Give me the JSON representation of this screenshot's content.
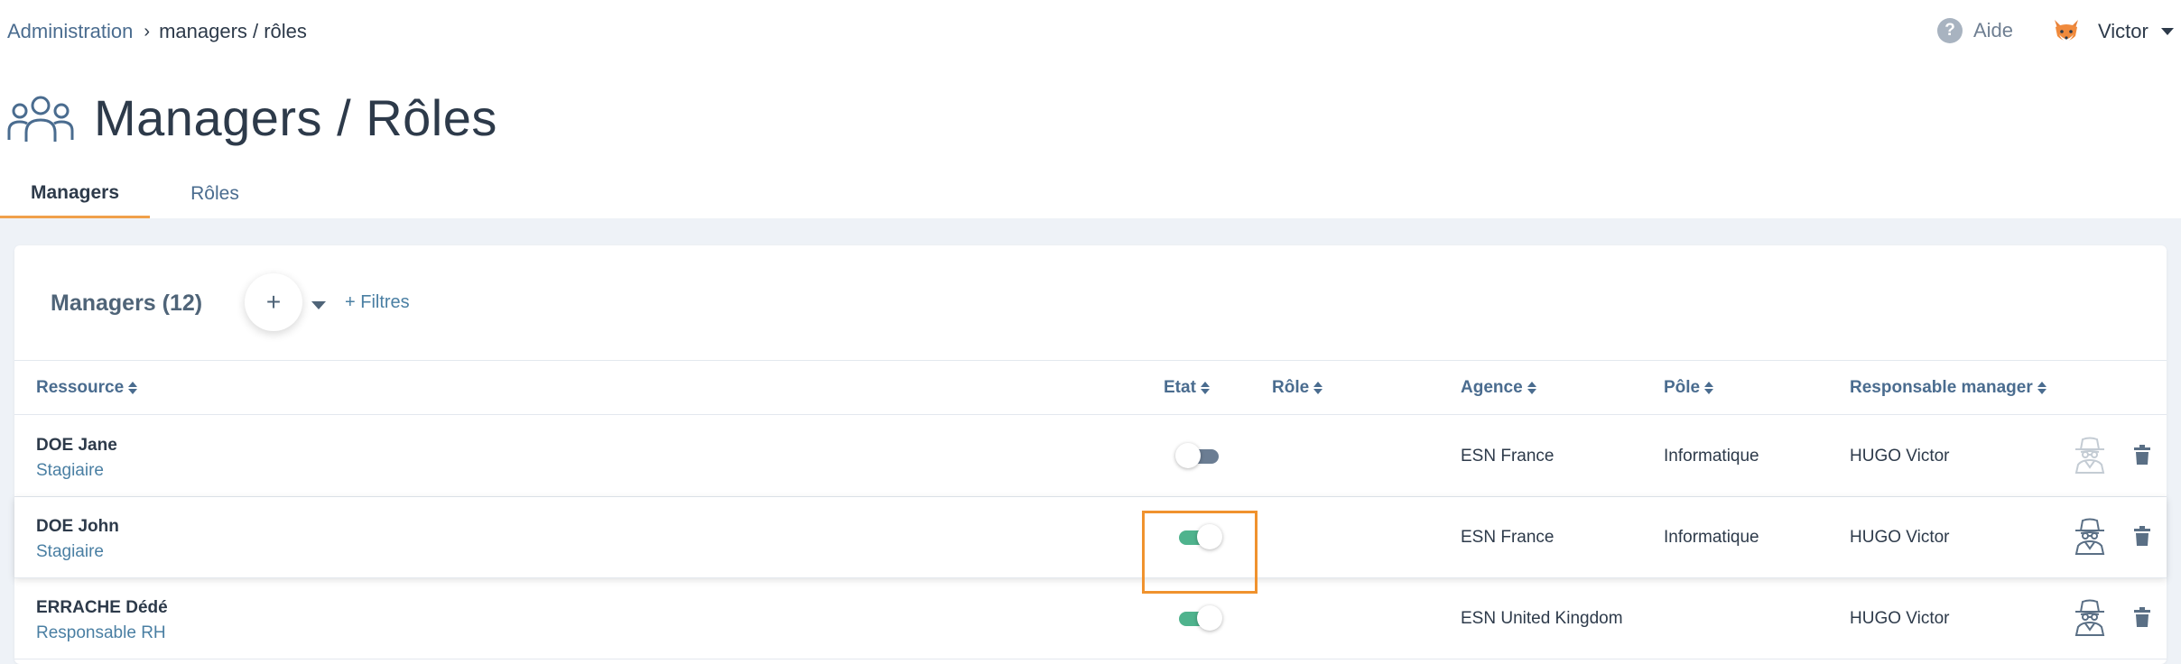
{
  "breadcrumb": {
    "parent": "Administration",
    "separator": "›",
    "current": "managers / rôles"
  },
  "header": {
    "help_label": "Aide",
    "user_name": "Victor",
    "help_glyph": "?"
  },
  "page": {
    "title": "Managers / Rôles"
  },
  "tabs": [
    {
      "label": "Managers",
      "active": true
    },
    {
      "label": "Rôles",
      "active": false
    }
  ],
  "card": {
    "title": "Managers (12)",
    "add_label": "+",
    "filters_label": "+ Filtres"
  },
  "table": {
    "headers": {
      "resource": "Ressource",
      "state": "Etat",
      "role": "Rôle",
      "agency": "Agence",
      "pole": "Pôle",
      "manager": "Responsable manager"
    },
    "rows": [
      {
        "name": "DOE Jane",
        "subtitle": "Stagiaire",
        "state": false,
        "role": "",
        "agency": "ESN France",
        "pole": "Informatique",
        "manager": "HUGO Victor",
        "impersonate_enabled": false
      },
      {
        "name": "DOE John",
        "subtitle": "Stagiaire",
        "state": true,
        "role": "",
        "agency": "ESN France",
        "pole": "Informatique",
        "manager": "HUGO Victor",
        "impersonate_enabled": true
      },
      {
        "name": "ERRACHE Dédé",
        "subtitle": "Responsable RH",
        "state": true,
        "role": "",
        "agency": "ESN United Kingdom",
        "pole": "",
        "manager": "HUGO Victor",
        "impersonate_enabled": true
      }
    ]
  },
  "icons": {
    "breadcrumb_separator": "chevron-right-icon",
    "help": "question-circle-icon",
    "avatar": "fox-avatar",
    "user_menu": "caret-down-icon",
    "title": "users-group-icon",
    "sort": "sort-icon",
    "impersonate": "spy-icon",
    "delete": "trash-icon"
  },
  "colors": {
    "accent": "#f0a04b",
    "toggle_on": "#4fb38d",
    "toggle_off": "#6b7d93",
    "link": "#4a7fa3",
    "highlight": "#f0922e",
    "background": "#eef2f7"
  }
}
